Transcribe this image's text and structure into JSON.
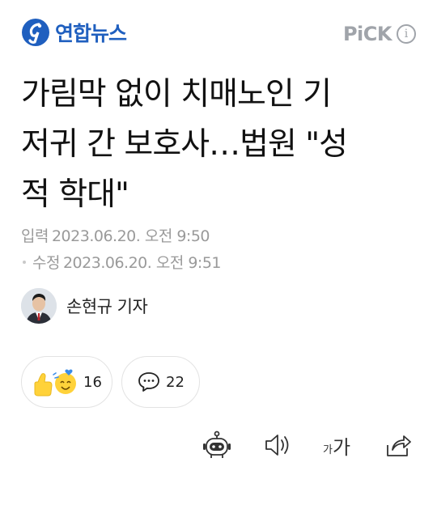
{
  "header": {
    "logo_text": "연합뉴스",
    "pick_label": "PiCK",
    "info_icon_text": "i"
  },
  "article": {
    "title_lines": [
      "가림막 없이 치매노인 기",
      "저귀 간 보호사…법원 \"성",
      "적 학대\""
    ],
    "input_label": "입력",
    "input_date": "2023.06.20. 오전 9:50",
    "edit_label": "수정",
    "edit_date": "2023.06.20. 오전 9:51",
    "author": "손현규 기자"
  },
  "reactions": {
    "like_count": "16",
    "comment_count": "22"
  },
  "toolbar": {
    "font_size_small": "가",
    "font_size_large": "가"
  },
  "colors": {
    "brand": "#1f5fbf",
    "pick_gray": "#a0a4aa",
    "meta_gray": "#9a9a9a"
  }
}
